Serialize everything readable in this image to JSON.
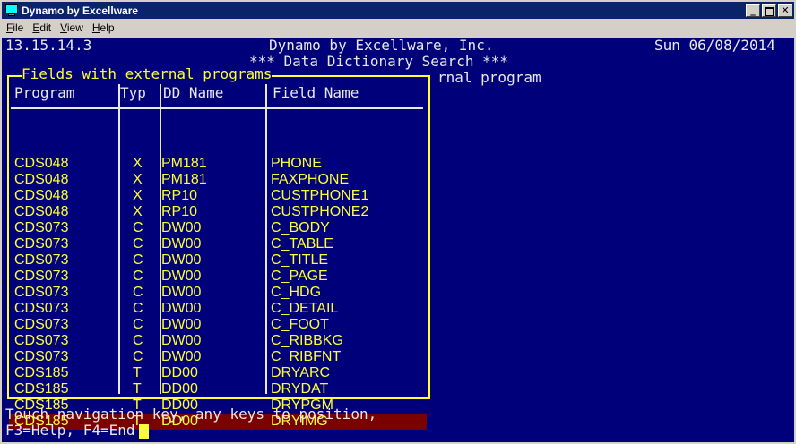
{
  "window": {
    "title": "Dynamo by Excellware"
  },
  "menu": [
    "File",
    "Edit",
    "View",
    "Help"
  ],
  "header": {
    "version": "13.15.14.3",
    "company": "Dynamo by Excellware, Inc.",
    "date": "Sun 06/08/2014",
    "subtitle": "*** Data Dictionary Search ***",
    "partial_text": "rnal program"
  },
  "popup": {
    "title": "Fields with external programs",
    "columns": [
      "Program",
      "Typ",
      "DD Name",
      "Field Name"
    ],
    "rows": [
      {
        "program": "CDS048",
        "typ": "X",
        "dd": "PM181",
        "field": "PHONE"
      },
      {
        "program": "CDS048",
        "typ": "X",
        "dd": "PM181",
        "field": "FAXPHONE"
      },
      {
        "program": "CDS048",
        "typ": "X",
        "dd": "RP10",
        "field": "CUSTPHONE1"
      },
      {
        "program": "CDS048",
        "typ": "X",
        "dd": "RP10",
        "field": "CUSTPHONE2"
      },
      {
        "program": "CDS073",
        "typ": "C",
        "dd": "DW00",
        "field": "C_BODY"
      },
      {
        "program": "CDS073",
        "typ": "C",
        "dd": "DW00",
        "field": "C_TABLE"
      },
      {
        "program": "CDS073",
        "typ": "C",
        "dd": "DW00",
        "field": "C_TITLE"
      },
      {
        "program": "CDS073",
        "typ": "C",
        "dd": "DW00",
        "field": "C_PAGE"
      },
      {
        "program": "CDS073",
        "typ": "C",
        "dd": "DW00",
        "field": "C_HDG"
      },
      {
        "program": "CDS073",
        "typ": "C",
        "dd": "DW00",
        "field": "C_DETAIL"
      },
      {
        "program": "CDS073",
        "typ": "C",
        "dd": "DW00",
        "field": "C_FOOT"
      },
      {
        "program": "CDS073",
        "typ": "C",
        "dd": "DW00",
        "field": "C_RIBBKG"
      },
      {
        "program": "CDS073",
        "typ": "C",
        "dd": "DW00",
        "field": "C_RIBFNT"
      },
      {
        "program": "CDS185",
        "typ": "T",
        "dd": "DD00",
        "field": "DRYARC"
      },
      {
        "program": "CDS185",
        "typ": "T",
        "dd": "DD00",
        "field": "DRYDAT"
      },
      {
        "program": "CDS185",
        "typ": "T",
        "dd": "DD00",
        "field": "DRYPGM"
      },
      {
        "program": "CDS185",
        "typ": "T",
        "dd": "DD00",
        "field": "DRYIMG",
        "selected": true
      }
    ]
  },
  "footer": {
    "line1": "Touch navigation key, any keys to position,",
    "line2": "F3=Help, F4=End"
  },
  "colors": {
    "terminal_bg": "#00007b",
    "yellow": "#ffff33",
    "white": "#e8e8e8",
    "selected_bg": "#7b0000",
    "titlebar": "#0a246a"
  }
}
